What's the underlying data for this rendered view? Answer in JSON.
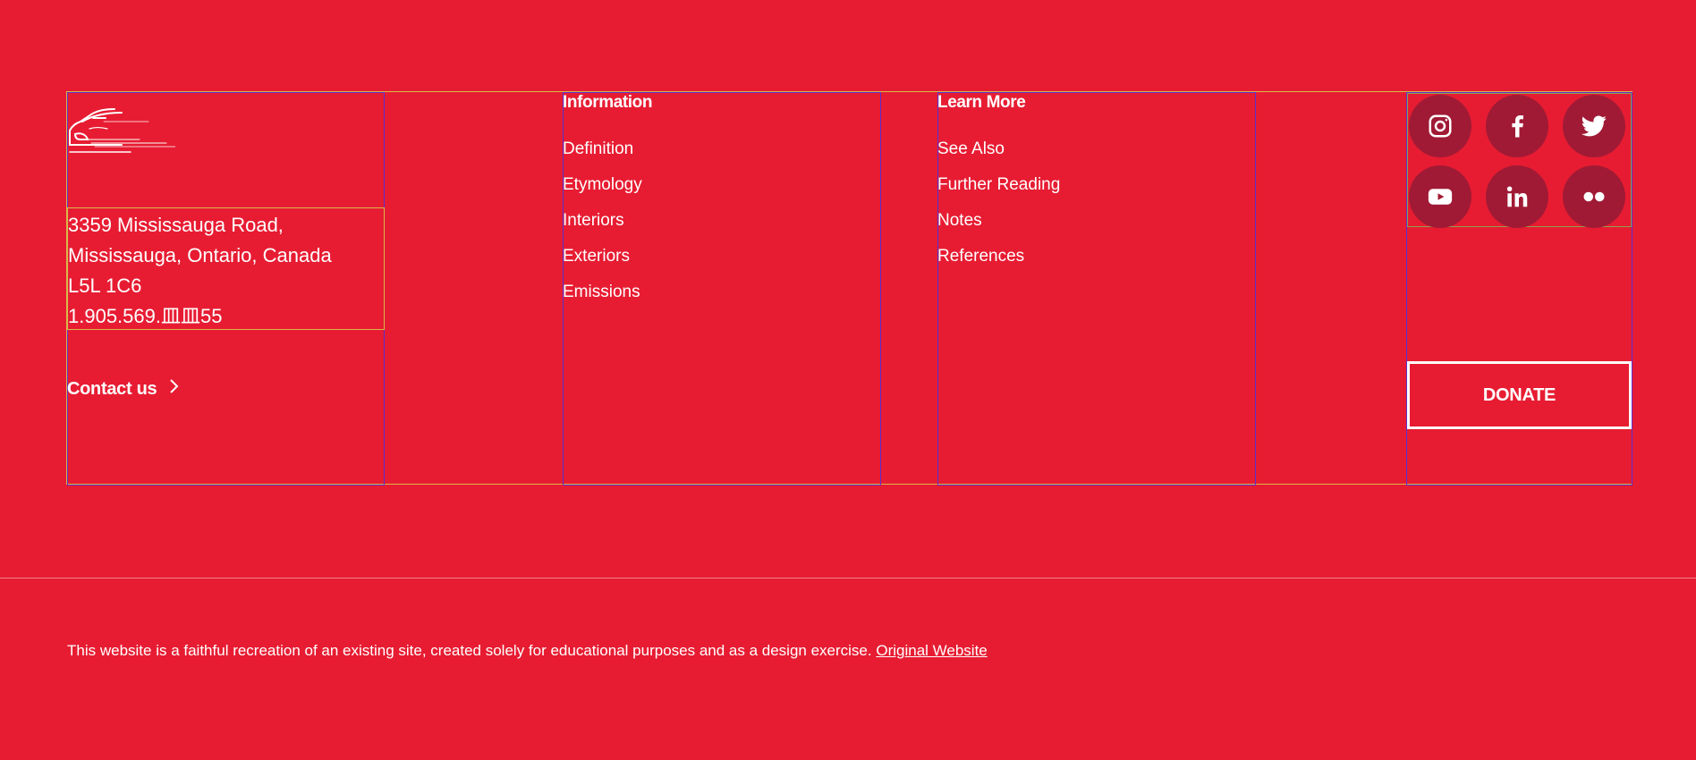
{
  "footer": {
    "logo_icon": "car-outline-icon",
    "address": {
      "line1": "3359 Mississauga Road,",
      "line2": "Mississauga, Ontario, Canada",
      "line3": "L5L 1C6",
      "phone": "1.905.569.⽫⽫55"
    },
    "contact_label": "Contact us",
    "columns": [
      {
        "title": "Information",
        "links": [
          "Definition",
          "Etymology",
          "Interiors",
          "Exteriors",
          "Emissions"
        ]
      },
      {
        "title": "Learn More",
        "links": [
          "See Also",
          "Further Reading",
          "Notes",
          "References"
        ]
      }
    ],
    "socials": [
      {
        "icon": "instagram-icon"
      },
      {
        "icon": "facebook-icon"
      },
      {
        "icon": "twitter-icon"
      },
      {
        "icon": "youtube-icon"
      },
      {
        "icon": "linkedin-icon"
      },
      {
        "icon": "flickr-icon"
      }
    ],
    "donate_label": "DONATE",
    "disclaimer_text": "This website is a faithful recreation of an existing site, created solely for educational purposes and as a design exercise.",
    "disclaimer_link": "Original Website"
  },
  "colors": {
    "background": "#e71c32",
    "social_circle": "#a01a35",
    "text": "#ffffff"
  }
}
